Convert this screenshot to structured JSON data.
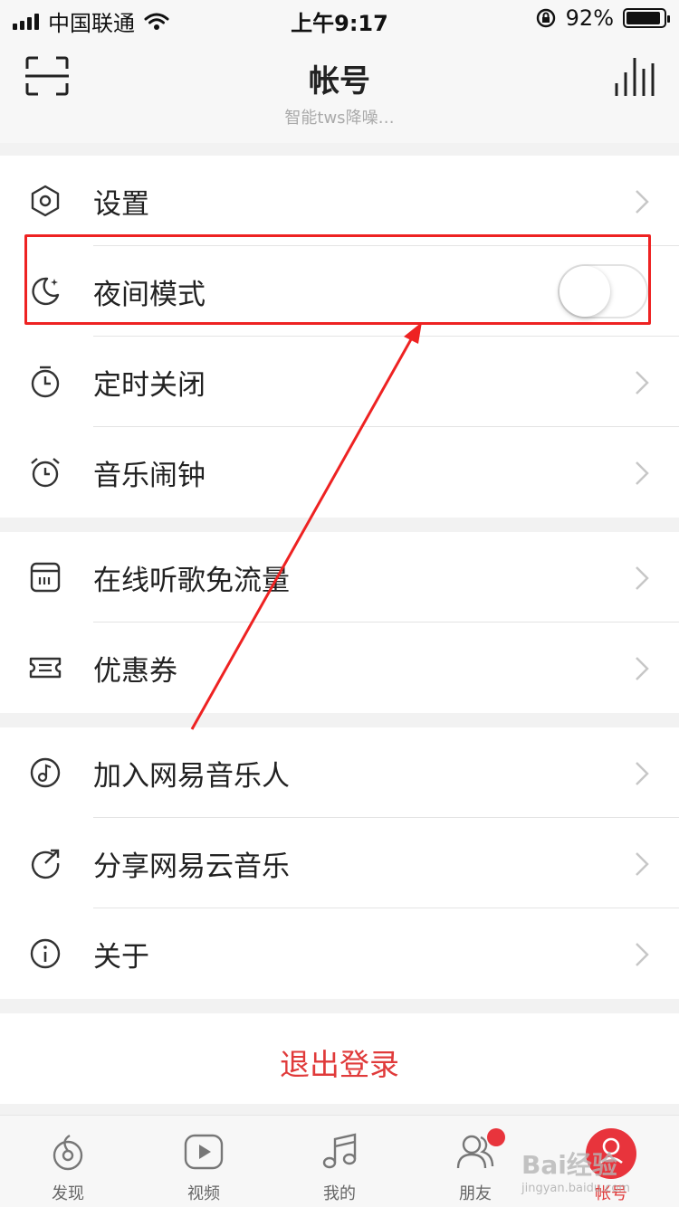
{
  "status_bar": {
    "carrier": "中国联通",
    "time": "上午9:17",
    "battery_percent": "92%",
    "battery_level": 0.92,
    "icons": [
      "signal-icon",
      "wifi-icon",
      "rotation-lock-icon",
      "battery-icon"
    ]
  },
  "nav": {
    "title": "帐号",
    "subtitle": "智能tws降噪…",
    "left_icon": "scan-icon",
    "right_icon": "audio-bars-icon"
  },
  "section1": [
    {
      "label": "设置",
      "icon": "hexagon-settings-icon",
      "type": "link"
    },
    {
      "label": "夜间模式",
      "icon": "moon-icon",
      "type": "toggle",
      "toggle_on": false
    },
    {
      "label": "定时关闭",
      "icon": "timer-icon",
      "type": "link"
    },
    {
      "label": "音乐闹钟",
      "icon": "alarm-clock-icon",
      "type": "link"
    }
  ],
  "section2": [
    {
      "label": "在线听歌免流量",
      "icon": "sim-card-icon",
      "type": "link"
    },
    {
      "label": "优惠券",
      "icon": "ticket-icon",
      "type": "link"
    }
  ],
  "section3": [
    {
      "label": "加入网易音乐人",
      "icon": "music-note-circle-icon",
      "type": "link"
    },
    {
      "label": "分享网易云音乐",
      "icon": "share-icon",
      "type": "link"
    },
    {
      "label": "关于",
      "icon": "info-icon",
      "type": "link"
    }
  ],
  "logout_label": "退出登录",
  "tabs": [
    {
      "label": "发现",
      "icon": "discover-icon",
      "active": false
    },
    {
      "label": "视频",
      "icon": "video-icon",
      "active": false
    },
    {
      "label": "我的",
      "icon": "music-icon",
      "active": false
    },
    {
      "label": "朋友",
      "icon": "friends-icon",
      "active": false,
      "badge": true
    },
    {
      "label": "帐号",
      "icon": "account-icon",
      "active": true
    }
  ],
  "colors": {
    "accent": "#e03a3a",
    "annotation": "#ee2222"
  },
  "watermark": {
    "brand": "Bai经验",
    "url": "jingyan.baidu.com"
  }
}
